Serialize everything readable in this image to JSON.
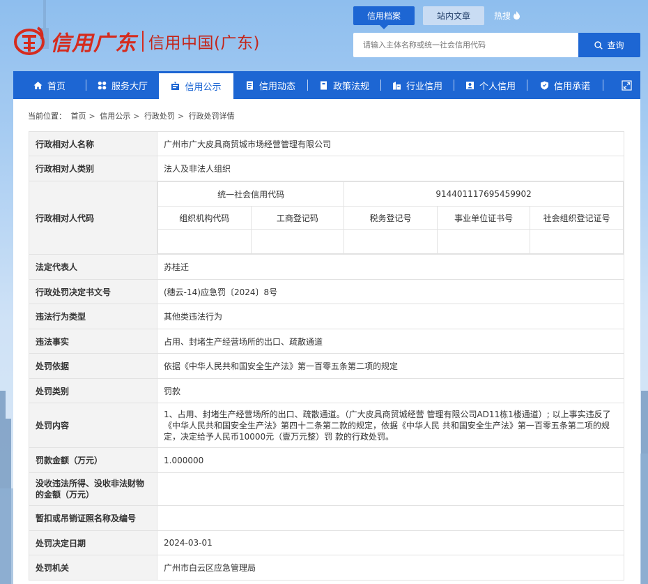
{
  "header": {
    "logo_script": "信用广东",
    "logo_title": "信用中国(广东)",
    "top_tabs": [
      {
        "label": "信用档案",
        "active": true
      },
      {
        "label": "站内文章",
        "active": false
      }
    ],
    "hot_label": "热搜",
    "search": {
      "placeholder": "请输入主体名称或统一社会信用代码",
      "button_label": "查询"
    }
  },
  "nav": {
    "items": [
      {
        "label": "首页",
        "icon": "home-icon"
      },
      {
        "label": "服务大厅",
        "icon": "grid-icon"
      },
      {
        "label": "信用公示",
        "icon": "bulletin-icon",
        "active": true
      },
      {
        "label": "信用动态",
        "icon": "document-icon"
      },
      {
        "label": "政策法规",
        "icon": "book-icon"
      },
      {
        "label": "行业信用",
        "icon": "building-icon"
      },
      {
        "label": "个人信用",
        "icon": "person-card-icon"
      },
      {
        "label": "信用承诺",
        "icon": "shield-check-icon"
      }
    ],
    "expand_icon": "expand-icon"
  },
  "breadcrumb": {
    "prefix": "当前位置：",
    "items": [
      "首页",
      "信用公示",
      "行政处罚",
      "行政处罚详情"
    ],
    "separator": ">"
  },
  "detail": {
    "rows": [
      {
        "label": "行政相对人名称",
        "value": "广州市广大皮具商贸城市场经营管理有限公司"
      },
      {
        "label": "行政相对人类别",
        "value": "法人及非法人组织"
      },
      {
        "label": "法定代表人",
        "value": "苏桂迁"
      },
      {
        "label": "行政处罚决定书文号",
        "value": "(穗云-14)应急罚〔2024〕8号"
      },
      {
        "label": "违法行为类型",
        "value": "其他类违法行为"
      },
      {
        "label": "违法事实",
        "value": "占用、封堵生产经营场所的出口、疏散通道"
      },
      {
        "label": "处罚依据",
        "value": "依据《中华人民共和国安全生产法》第一百零五条第二项的规定"
      },
      {
        "label": "处罚类别",
        "value": "罚款"
      },
      {
        "label": "处罚内容",
        "value": "1、占用、封堵生产经营场所的出口、疏散通道。（广大皮具商贸城经营 管理有限公司AD11栋1楼通道）; 以上事实违反了《中华人民共和国安全生产法》第四十二条第二款的规定，依据《中华人民 共和国安全生产法》第一百零五条第二项的规定，决定给予人民币10000元（壹万元整）罚 款的行政处罚。"
      },
      {
        "label": "罚款金额（万元）",
        "value": "1.000000"
      },
      {
        "label": "没收违法所得、没收非法财物的金额（万元）",
        "value": ""
      },
      {
        "label": "暂扣或吊销证照名称及编号",
        "value": ""
      },
      {
        "label": "处罚决定日期",
        "value": "2024-03-01"
      },
      {
        "label": "处罚机关",
        "value": "广州市白云区应急管理局"
      }
    ],
    "code_row": {
      "label": "行政相对人代码",
      "usc_label": "统一社会信用代码",
      "usc_value": "914401117695459902",
      "sub_headers": [
        "组织机构代码",
        "工商登记码",
        "税务登记号",
        "事业单位证书号",
        "社会组织登记证号"
      ],
      "sub_values": [
        "",
        "",
        "",
        "",
        ""
      ]
    }
  },
  "colors": {
    "primary_blue": "#1d66d3",
    "logo_red": "#d52b1e",
    "label_bg": "#f3f3f3",
    "border": "#e2e2e2"
  }
}
